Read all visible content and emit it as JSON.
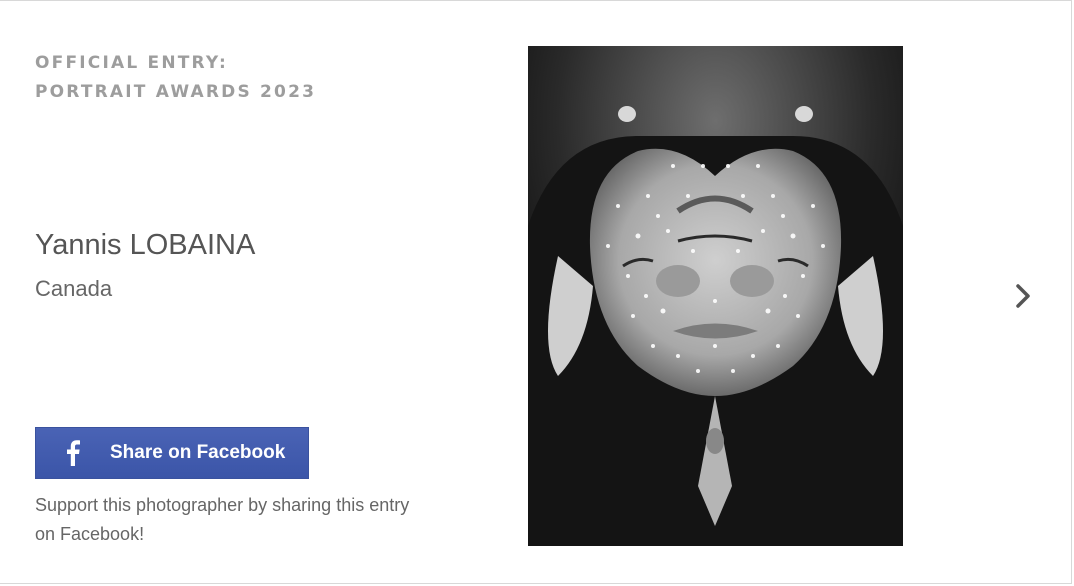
{
  "entry": {
    "label_line1": "OFFICIAL ENTRY:",
    "label_line2": "PORTRAIT AWARDS 2023"
  },
  "photographer": {
    "name": "Yannis LOBAINA",
    "country": "Canada"
  },
  "share": {
    "button_label": "Share on Facebook",
    "support_text": "Support this photographer by sharing this entry on Facebook!"
  },
  "icons": {
    "share": "facebook-icon",
    "next": "chevron-right-icon"
  },
  "colors": {
    "facebook_blue": "#3b55a8",
    "label_gray": "#8c8c8c",
    "text_gray": "#555555"
  }
}
